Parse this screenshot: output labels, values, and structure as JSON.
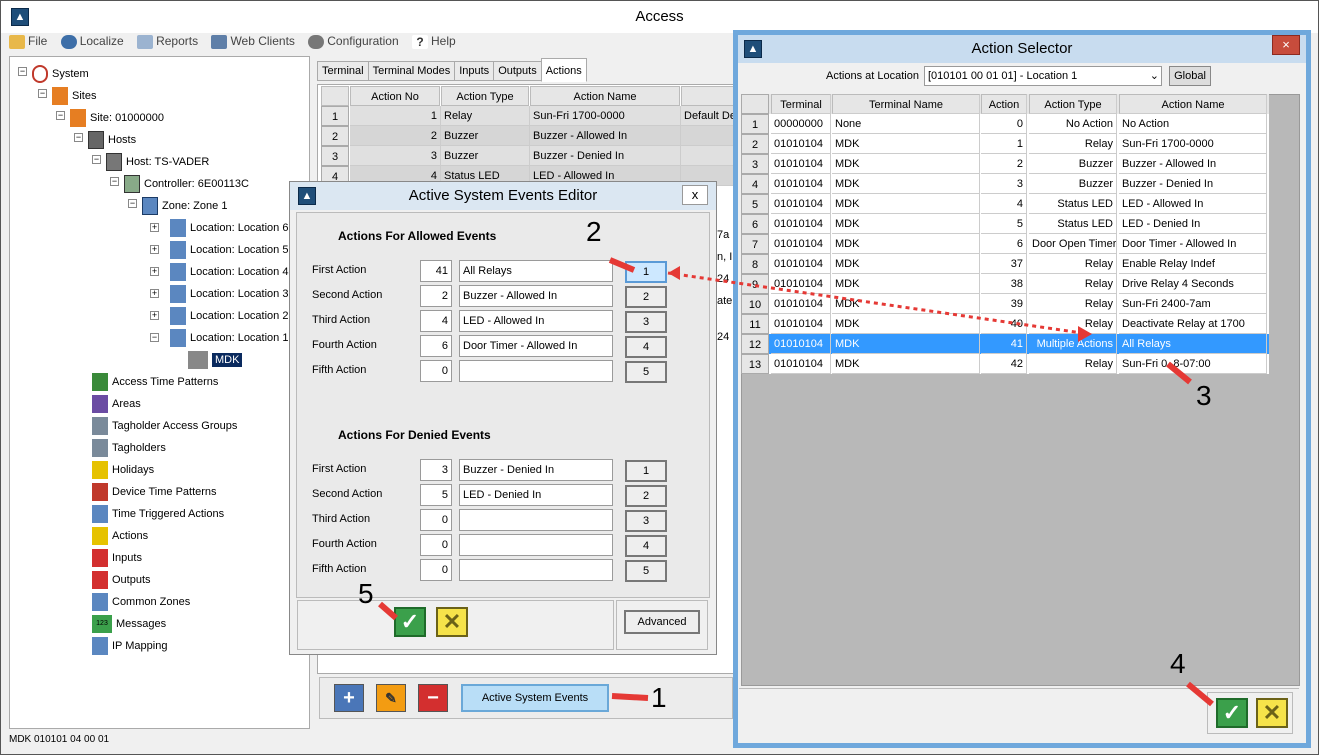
{
  "main": {
    "title": "Access",
    "menu": [
      "File",
      "Localize",
      "Reports",
      "Web Clients",
      "Configuration",
      "Help"
    ],
    "status": "MDK 010101 04 00 01"
  },
  "tree": {
    "system": "System",
    "sites": "Sites",
    "site": "Site: 01000000",
    "hosts": "Hosts",
    "host": "Host: TS-VADER",
    "controller": "Controller: 6E00113C",
    "zone": "Zone: Zone 1",
    "locations": [
      "Location: Location 6",
      "Location: Location 5",
      "Location: Location 4",
      "Location: Location 3",
      "Location: Location 2",
      "Location: Location 1"
    ],
    "mdk": "MDK",
    "items": [
      "Access Time Patterns",
      "Areas",
      "Tagholder Access Groups",
      "Tagholders",
      "Holidays",
      "Device Time Patterns",
      "Time Triggered Actions",
      "Actions",
      "Inputs",
      "Outputs",
      "Common Zones",
      "Messages",
      "IP Mapping"
    ],
    "messages_icon_text": "123"
  },
  "tabs": [
    "Terminal",
    "Terminal Modes",
    "Inputs",
    "Outputs",
    "Actions"
  ],
  "action_grid": {
    "headers": [
      "Action No",
      "Action Type",
      "Action Name"
    ],
    "rows": [
      {
        "rn": "1",
        "no": "1",
        "type": "Relay",
        "name": "Sun-Fri 1700-0000",
        "extra": "Default De"
      },
      {
        "rn": "2",
        "no": "2",
        "type": "Buzzer",
        "name": "Buzzer - Allowed In",
        "extra": ""
      },
      {
        "rn": "3",
        "no": "3",
        "type": "Buzzer",
        "name": "Buzzer - Denied In",
        "extra": ""
      },
      {
        "rn": "4",
        "no": "4",
        "type": "Status LED",
        "name": "LED - Allowed In",
        "extra": ""
      }
    ],
    "peek": [
      "7a",
      "n, I",
      "24",
      "ate",
      "24"
    ]
  },
  "toolbar": {
    "active_system_events": "Active System Events"
  },
  "editor": {
    "title": "Active System Events Editor",
    "allowed_header": "Actions For Allowed Events",
    "denied_header": "Actions For Denied Events",
    "allowed": [
      {
        "label": "First Action",
        "num": "41",
        "name": "All Relays",
        "btn": "1"
      },
      {
        "label": "Second Action",
        "num": "2",
        "name": "Buzzer - Allowed In",
        "btn": "2"
      },
      {
        "label": "Third Action",
        "num": "4",
        "name": "LED - Allowed In",
        "btn": "3"
      },
      {
        "label": "Fourth Action",
        "num": "6",
        "name": "Door Timer - Allowed In",
        "btn": "4"
      },
      {
        "label": "Fifth Action",
        "num": "0",
        "name": "",
        "btn": "5"
      }
    ],
    "denied": [
      {
        "label": "First Action",
        "num": "3",
        "name": "Buzzer - Denied In",
        "btn": "1"
      },
      {
        "label": "Second Action",
        "num": "5",
        "name": "LED - Denied In",
        "btn": "2"
      },
      {
        "label": "Third Action",
        "num": "0",
        "name": "",
        "btn": "3"
      },
      {
        "label": "Fourth Action",
        "num": "0",
        "name": "",
        "btn": "4"
      },
      {
        "label": "Fifth Action",
        "num": "0",
        "name": "",
        "btn": "5"
      }
    ],
    "advanced": "Advanced",
    "close": "x"
  },
  "selector": {
    "title": "Action Selector",
    "location_label": "Actions at Location",
    "location_value": "[010101 00 01 01] - Location 1",
    "global": "Global",
    "headers": [
      "Terminal",
      "Terminal Name",
      "Action",
      "Action Type",
      "Action Name"
    ],
    "rows": [
      {
        "rn": "1",
        "terminal": "00000000",
        "tname": "None",
        "action": "0",
        "type": "No Action",
        "name": "No Action"
      },
      {
        "rn": "2",
        "terminal": "01010104",
        "tname": "MDK",
        "action": "1",
        "type": "Relay",
        "name": "Sun-Fri 1700-0000"
      },
      {
        "rn": "3",
        "terminal": "01010104",
        "tname": "MDK",
        "action": "2",
        "type": "Buzzer",
        "name": "Buzzer - Allowed In"
      },
      {
        "rn": "4",
        "terminal": "01010104",
        "tname": "MDK",
        "action": "3",
        "type": "Buzzer",
        "name": "Buzzer - Denied In"
      },
      {
        "rn": "5",
        "terminal": "01010104",
        "tname": "MDK",
        "action": "4",
        "type": "Status LED",
        "name": "LED - Allowed In"
      },
      {
        "rn": "6",
        "terminal": "01010104",
        "tname": "MDK",
        "action": "5",
        "type": "Status LED",
        "name": "LED - Denied In"
      },
      {
        "rn": "7",
        "terminal": "01010104",
        "tname": "MDK",
        "action": "6",
        "type": "Door Open Timer",
        "name": "Door Timer - Allowed In"
      },
      {
        "rn": "8",
        "terminal": "01010104",
        "tname": "MDK",
        "action": "37",
        "type": "Relay",
        "name": "Enable Relay Indef"
      },
      {
        "rn": "9",
        "terminal": "01010104",
        "tname": "MDK",
        "action": "38",
        "type": "Relay",
        "name": "Drive Relay 4 Seconds"
      },
      {
        "rn": "10",
        "terminal": "01010104",
        "tname": "MDK",
        "action": "39",
        "type": "Relay",
        "name": "Sun-Fri 2400-7am"
      },
      {
        "rn": "11",
        "terminal": "01010104",
        "tname": "MDK",
        "action": "40",
        "type": "Relay",
        "name": "Deactivate Relay at 1700"
      },
      {
        "rn": "12",
        "terminal": "01010104",
        "tname": "MDK",
        "action": "41",
        "type": "Multiple Actions",
        "name": "All Relays"
      },
      {
        "rn": "13",
        "terminal": "01010104",
        "tname": "MDK",
        "action": "42",
        "type": "Relay",
        "name": "Sun-Fri 0..8-07:00"
      }
    ],
    "selected_index": 11
  },
  "annotations": [
    "1",
    "2",
    "3",
    "4",
    "5"
  ],
  "colors": {
    "selected_row": "#3399ff",
    "ok": "#3ba04b",
    "cancel": "#f6e34a",
    "arrow": "#e53935"
  }
}
